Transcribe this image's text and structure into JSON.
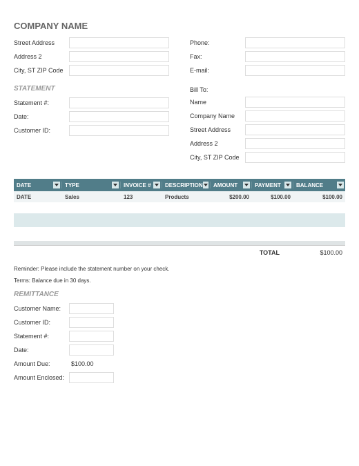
{
  "company": {
    "title": "COMPANY NAME",
    "fields_left": [
      {
        "label": "Street Address"
      },
      {
        "label": "Address 2"
      },
      {
        "label": "City, ST  ZIP Code"
      }
    ],
    "fields_right": [
      {
        "label": "Phone:"
      },
      {
        "label": "Fax:"
      },
      {
        "label": "E-mail:"
      }
    ]
  },
  "statement": {
    "title": "STATEMENT",
    "fields": [
      {
        "label": "Statement #:"
      },
      {
        "label": "Date:"
      },
      {
        "label": "Customer ID:"
      }
    ]
  },
  "billto": {
    "title": "Bill To:",
    "fields": [
      {
        "label": "Name"
      },
      {
        "label": "Company Name"
      },
      {
        "label": "Street Address"
      },
      {
        "label": "Address 2"
      },
      {
        "label": "City, ST  ZIP Code"
      }
    ]
  },
  "table": {
    "headers": [
      "DATE",
      "TYPE",
      "INVOICE #",
      "DESCRIPTION",
      "AMOUNT",
      "PAYMENT",
      "BALANCE"
    ],
    "row": {
      "date": "DATE",
      "type": "Sales",
      "invoice": "123",
      "description": "Products",
      "amount": "$200.00",
      "payment": "$100.00",
      "balance": "$100.00"
    },
    "total_label": "TOTAL",
    "total_value": "$100.00"
  },
  "reminder": "Reminder: Please include the statement number on your check.",
  "terms": "Terms: Balance due in 30 days.",
  "remittance": {
    "title": "REMITTANCE",
    "rows": [
      {
        "label": "Customer Name:",
        "type": "input"
      },
      {
        "label": "Customer ID:",
        "type": "input"
      },
      {
        "label": "Statement #:",
        "type": "input"
      },
      {
        "label": "Date:",
        "type": "input"
      },
      {
        "label": "Amount Due:",
        "type": "value",
        "value": "$100.00"
      },
      {
        "label": "Amount Enclosed:",
        "type": "input"
      }
    ]
  },
  "chart_data": {
    "type": "table",
    "title": "Billing Statement Line Items",
    "columns": [
      "DATE",
      "TYPE",
      "INVOICE #",
      "DESCRIPTION",
      "AMOUNT",
      "PAYMENT",
      "BALANCE"
    ],
    "rows": [
      [
        "DATE",
        "Sales",
        123,
        "Products",
        200.0,
        100.0,
        100.0
      ]
    ],
    "total": 100.0
  }
}
